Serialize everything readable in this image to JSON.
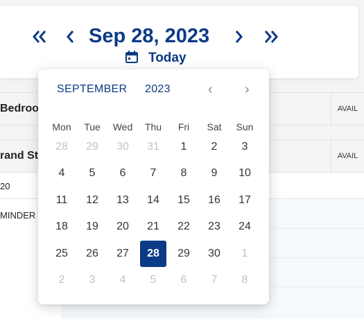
{
  "nav": {
    "first_icon": "double-chevron-left-icon",
    "prev_icon": "chevron-left-icon",
    "current_date": "Sep 28, 2023",
    "next_icon": "chevron-right-icon",
    "last_icon": "double-chevron-right-icon",
    "today_icon": "calendar-icon",
    "today_label": "Today"
  },
  "background": {
    "row1_label": "Bedroom",
    "row1_avail": "AVAIL",
    "row2_label": "rand Stu",
    "row2_avail": "AVAIL",
    "row3_label": "20",
    "row4_label": "MINDER"
  },
  "calendar": {
    "month": "SEPTEMBER",
    "year": "2023",
    "prev_arrow": "‹",
    "next_arrow": "›",
    "weekdays": [
      "Mon",
      "Tue",
      "Wed",
      "Thu",
      "Fri",
      "Sat",
      "Sun"
    ],
    "weeks": [
      [
        "28",
        "29",
        "30",
        "31",
        "1",
        "2",
        "3"
      ],
      [
        "4",
        "5",
        "6",
        "7",
        "8",
        "9",
        "10"
      ],
      [
        "11",
        "12",
        "13",
        "14",
        "15",
        "16",
        "17"
      ],
      [
        "18",
        "19",
        "20",
        "21",
        "22",
        "23",
        "24"
      ],
      [
        "25",
        "26",
        "27",
        "28",
        "29",
        "30",
        "1"
      ],
      [
        "2",
        "3",
        "4",
        "5",
        "6",
        "7",
        "8"
      ]
    ],
    "selected_day": "28",
    "colors": {
      "accent": "#0b3a86",
      "muted_text": "#c2c2c2"
    }
  }
}
